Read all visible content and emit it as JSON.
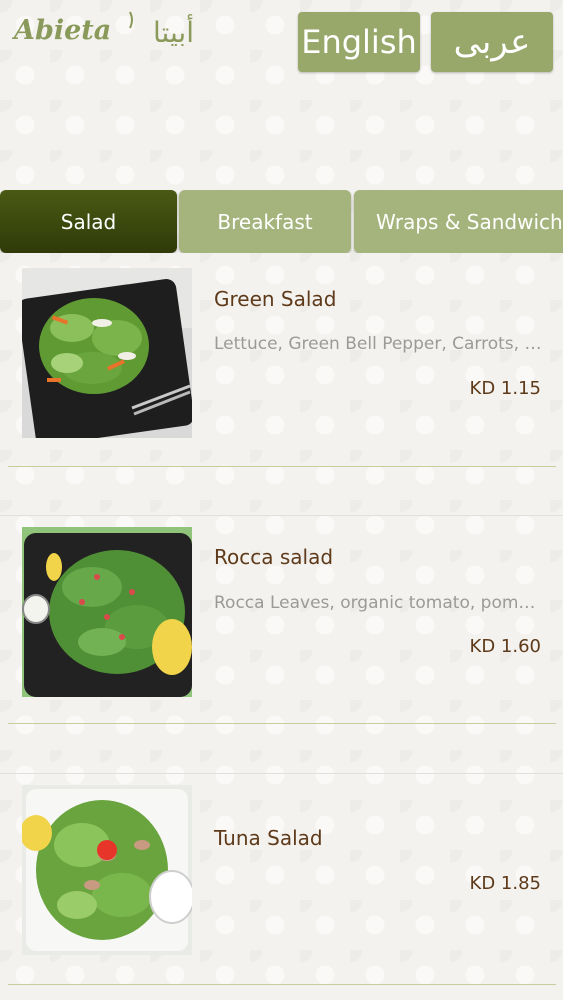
{
  "header": {
    "logo_text_en": "Abieta",
    "logo_text_ar": "أبيتا",
    "lang_english": "English",
    "lang_arabic": "عربى"
  },
  "tabs": [
    {
      "label": "Salad",
      "active": true
    },
    {
      "label": "Breakfast",
      "active": false
    },
    {
      "label": "Wraps & Sandwiches",
      "active": false
    }
  ],
  "items": [
    {
      "name": "Green Salad",
      "description": "Lettuce, Green Bell Pepper, Carrots, Cucumber",
      "price": "KD 1.15",
      "image": "green-salad-plate"
    },
    {
      "name": "Rocca salad",
      "description": "Rocca Leaves, organic tomato, pomegranate",
      "price": "KD 1.60",
      "image": "rocca-salad-plate"
    },
    {
      "name": "Tuna Salad",
      "description": "",
      "price": "KD 1.85",
      "image": "tuna-salad-plate"
    }
  ],
  "colors": {
    "accent": "#98a86a",
    "tab_active": "#3b4a0c",
    "tab_inactive": "#a5b47c",
    "item_text": "#5e3a1a"
  }
}
